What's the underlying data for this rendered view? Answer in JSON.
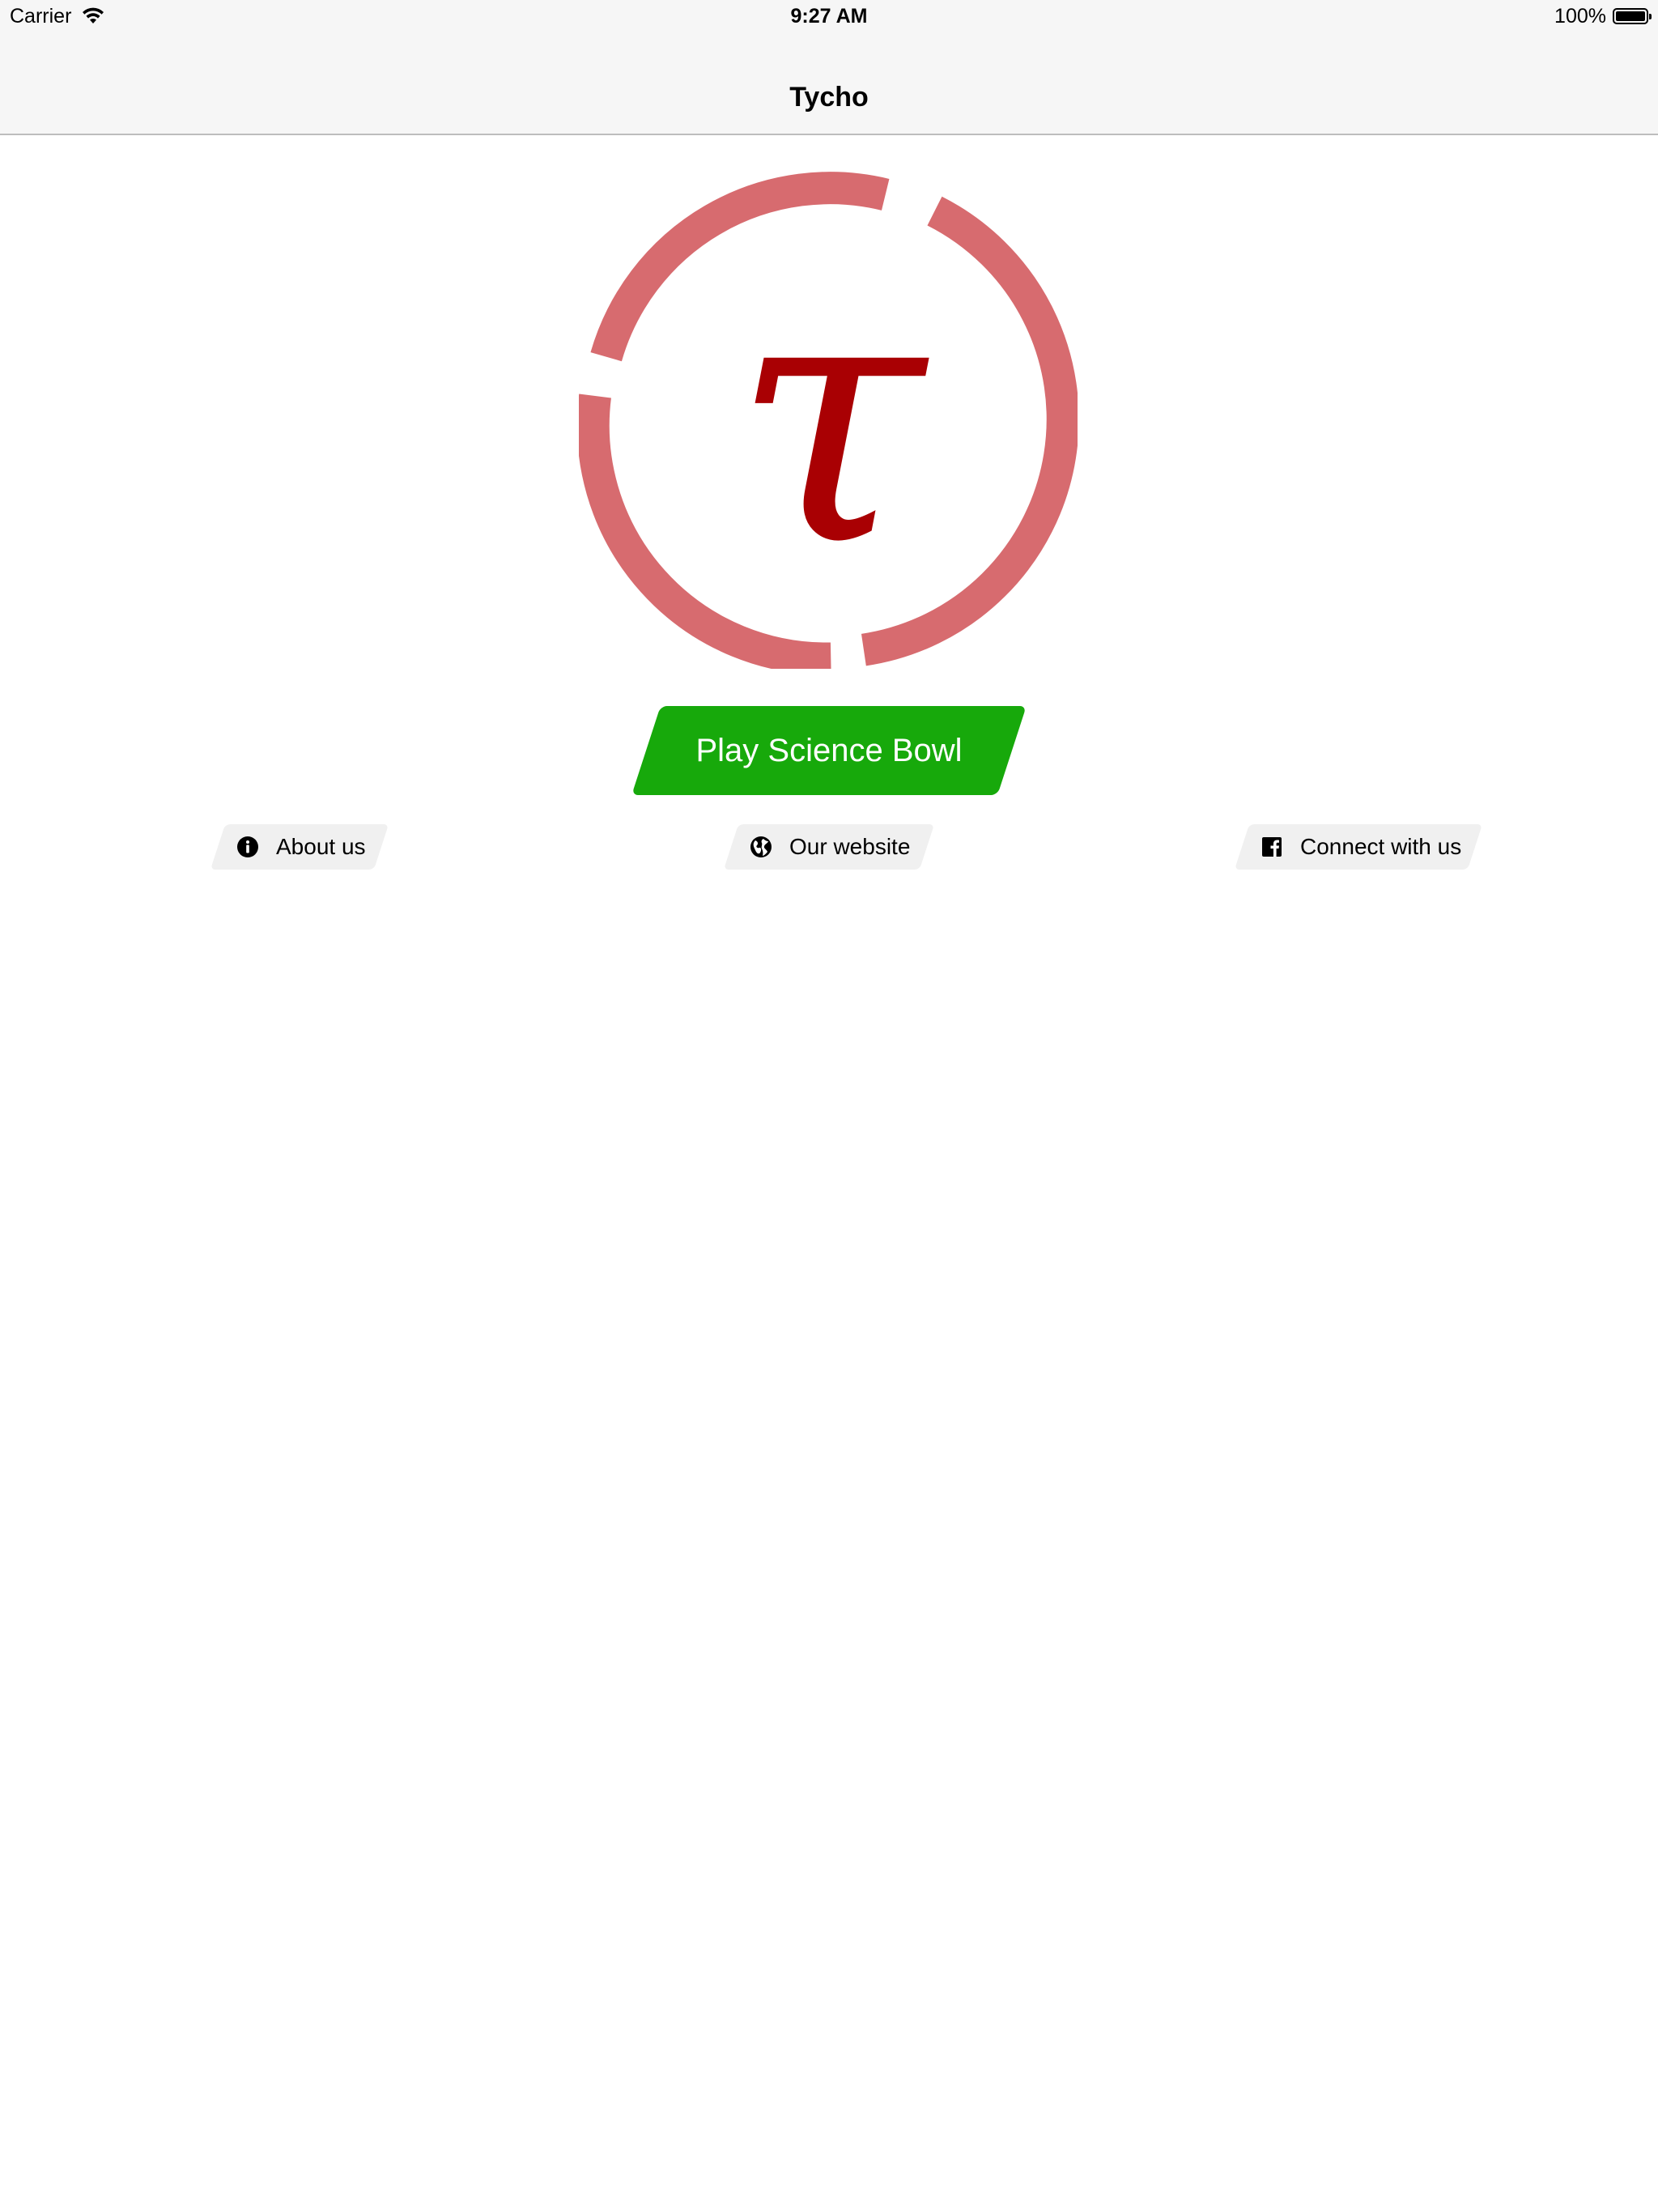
{
  "status_bar": {
    "carrier": "Carrier",
    "time": "9:27 AM",
    "battery": "100%"
  },
  "nav": {
    "title": "Tycho"
  },
  "logo": {
    "glyph": "τ",
    "ring_color": "#d76b6f",
    "glyph_color": "#a90003"
  },
  "main": {
    "play_label": "Play Science Bowl",
    "play_color": "#17a90b",
    "links": [
      {
        "label": "About us",
        "icon": "info-icon"
      },
      {
        "label": "Our website",
        "icon": "globe-icon"
      },
      {
        "label": "Connect with us",
        "icon": "facebook-icon"
      }
    ]
  }
}
